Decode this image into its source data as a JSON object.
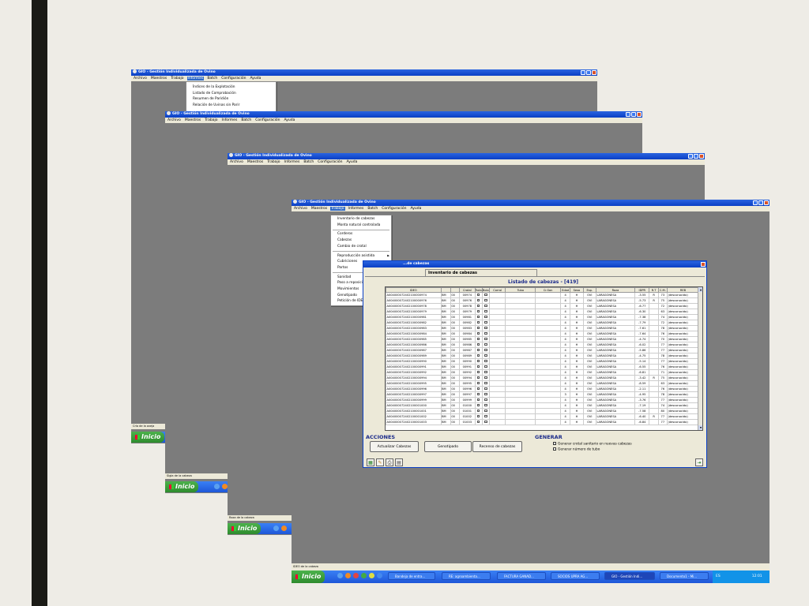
{
  "app_title": "GIO - Gestión Individualizada de Ovino",
  "menu": [
    "Archivo",
    "Maestros",
    "Trabajo",
    "Informes",
    "Batch",
    "Configuración",
    "Ayuda"
  ],
  "informes_menu": [
    "Índices de la Explotación",
    "Listado de Comprobación",
    "Resumen de Paridión",
    "Relación de Uvinas sin Parir"
  ],
  "trabajo_menu": [
    {
      "label": "Inventario de cabezas",
      "sep_after": false,
      "sub": false
    },
    {
      "label": "Monta natural controlada",
      "sep_after": true,
      "sub": false
    },
    {
      "label": "Corderos",
      "sep_after": false,
      "sub": false
    },
    {
      "label": "Cabezas",
      "sep_after": false,
      "sub": false
    },
    {
      "label": "Cambio de crotal",
      "sep_after": true,
      "sub": false
    },
    {
      "label": "Reproducción asistida",
      "sep_after": false,
      "sub": true
    },
    {
      "label": "Cubriciones",
      "sep_after": false,
      "sub": false
    },
    {
      "label": "Partos",
      "sep_after": true,
      "sub": false
    },
    {
      "label": "Sanidad",
      "sep_after": false,
      "sub": true
    },
    {
      "label": "Paso a reposición",
      "sep_after": false,
      "sub": false
    },
    {
      "label": "Movimientos",
      "sep_after": false,
      "sub": true
    },
    {
      "label": "Genotipado",
      "sep_after": false,
      "sub": false
    },
    {
      "label": "Petición de IDEO Perdido",
      "sep_after": false,
      "sub": false
    }
  ],
  "statuslines": [
    "Cría de la oveja",
    "Sigla de la cabeza",
    "Raza de la cabeza",
    "IDEO de la cabeza"
  ],
  "start_label": "Inicio",
  "dialog": {
    "title": "...de cabezas",
    "tab": "Inventario de cabezas",
    "list_title": "Listado de cabezas - [419]",
    "columns": [
      "IDEO",
      "",
      "",
      "Crotal",
      "Ruta",
      "Bolo",
      "Corral",
      "Tubo",
      "Cr.San",
      "Edad",
      "Sexo",
      "Esp.",
      "Raza",
      "IDPR",
      "R.T",
      "C.M.",
      "REB"
    ],
    "rows": [
      [
        "A004000072402100000974",
        "BM",
        "00",
        "00974",
        "4",
        "H",
        "OVI",
        "LARAGONESA",
        "-3.55",
        "R",
        "73",
        "(desconocido)"
      ],
      [
        "A004000072402100000976",
        "BM",
        "00",
        "00976",
        "4",
        "H",
        "OVI",
        "LARAGONESA",
        "-5.73",
        "R",
        "75",
        "(desconocido)"
      ],
      [
        "A004000072402100000978",
        "BM",
        "00",
        "00978",
        "4",
        "H",
        "OVI",
        "LARAGONESA",
        "-6.77",
        "",
        "72",
        "(desconocido)"
      ],
      [
        "A004000072402100000979",
        "BM",
        "00",
        "00979",
        "4",
        "H",
        "OVI",
        "LARAGONESA",
        "-6.30",
        "",
        "63",
        "(desconocido)"
      ],
      [
        "A004000072402100000981",
        "BM",
        "00",
        "00981",
        "4",
        "H",
        "OVI",
        "LARAGONESA",
        "-7.38",
        "",
        "74",
        "(desconocido)"
      ],
      [
        "A004000072402100000982",
        "BM",
        "00",
        "00982",
        "4",
        "H",
        "OVI",
        "LARAGONESA",
        "-7.79",
        "",
        "72",
        "(desconocido)"
      ],
      [
        "A004000072402100000983",
        "BM",
        "00",
        "00983",
        "4",
        "H",
        "OVI",
        "LARAGONESA",
        "-7.61",
        "",
        "78",
        "(desconocido)"
      ],
      [
        "A004000072402100000984",
        "BM",
        "00",
        "00984",
        "4",
        "H",
        "OVI",
        "LARAGONESA",
        "-7.64",
        "",
        "76",
        "(desconocido)"
      ],
      [
        "A004000072402100000985",
        "BM",
        "00",
        "00985",
        "4",
        "H",
        "OVI",
        "LARAGONESA",
        "-4.74",
        "",
        "70",
        "(desconocido)"
      ],
      [
        "A004000072402100000986",
        "BM",
        "00",
        "00986",
        "4",
        "H",
        "OVI",
        "LARAGONESA",
        "-6.02",
        "",
        "77",
        "(desconocido)"
      ],
      [
        "A004000072402100000987",
        "BM",
        "00",
        "00987",
        "4",
        "H",
        "OVI",
        "LARAGONESA",
        "-5.86",
        "",
        "77",
        "(desconocido)"
      ],
      [
        "A004000072402100000989",
        "BM",
        "00",
        "00989",
        "4",
        "H",
        "OVI",
        "LARAGONESA",
        "-4.75",
        "",
        "78",
        "(desconocido)"
      ],
      [
        "A004000072402100000990",
        "BM",
        "00",
        "00990",
        "4",
        "H",
        "OVI",
        "LARAGONESA",
        "-5.14",
        "",
        "77",
        "(desconocido)"
      ],
      [
        "A004000072402100000991",
        "BM",
        "00",
        "00991",
        "4",
        "H",
        "OVI",
        "LARAGONESA",
        "-6.55",
        "",
        "76",
        "(desconocido)"
      ],
      [
        "A004000072402100000992",
        "BM",
        "00",
        "00992",
        "4",
        "H",
        "OVI",
        "LARAGONESA",
        "-6.81",
        "",
        "71",
        "(desconocido)"
      ],
      [
        "A004000072402100000994",
        "BM",
        "00",
        "00994",
        "4",
        "H",
        "OVI",
        "LARAGONESA",
        "-3.42",
        "R",
        "75",
        "(desconocido)"
      ],
      [
        "A004000072402100000995",
        "BM",
        "00",
        "00995",
        "4",
        "H",
        "OVI",
        "LARAGONESA",
        "-8.59",
        "",
        "63",
        "(desconocido)"
      ],
      [
        "A004000072402100000996",
        "BM",
        "00",
        "00996",
        "4",
        "H",
        "OVI",
        "LARAGONESA",
        "-2.11",
        "",
        "76",
        "(desconocido)"
      ],
      [
        "A004000072402100000997",
        "BM",
        "00",
        "00997",
        "3",
        "H",
        "OVI",
        "LARAGONESA",
        "-4.95",
        "",
        "78",
        "(desconocido)"
      ],
      [
        "A004000072402100000999",
        "BM",
        "00",
        "00999",
        "4",
        "H",
        "OVI",
        "LARAGONESA",
        "-3.76",
        "",
        "77",
        "(desconocido)"
      ],
      [
        "A004000072402100001000",
        "BM",
        "00",
        "01000",
        "4",
        "H",
        "OVI",
        "LARAGONESA",
        "-7.19",
        "",
        "74",
        "(desconocido)"
      ],
      [
        "A004000072402100001001",
        "BM",
        "00",
        "01001",
        "4",
        "H",
        "OVI",
        "LARAGONESA",
        "-7.58",
        "",
        "80",
        "(desconocido)"
      ],
      [
        "A004000072402100001002",
        "BM",
        "00",
        "01002",
        "4",
        "H",
        "OVI",
        "LARAGONESA",
        "-6.40",
        "R",
        "77",
        "(desconocido)"
      ],
      [
        "A004000072402100001003",
        "BM",
        "00",
        "01003",
        "4",
        "H",
        "OVI",
        "LARAGONESA",
        "-6.84",
        "",
        "77",
        "(desconocido)"
      ]
    ],
    "acciones_label": "ACCIONES",
    "generar_label": "GENERAR",
    "buttons": [
      "Actualizar Cabezas",
      "Genotipado",
      "Recenso de cabezas"
    ],
    "checkboxes": [
      "Generar crotal sanitario en nuevas cabezas",
      "Generar número de tubo"
    ]
  },
  "taskbar_items": [
    "Bandeja de entra...",
    "RE: agroambienta...",
    "FACTURA GANAD...",
    "SOCIOS UPRA AG...",
    "GIO - Gestión Indi...",
    "Documento1 - Mi..."
  ],
  "tray": {
    "lang": "ES",
    "time": "12:01"
  }
}
